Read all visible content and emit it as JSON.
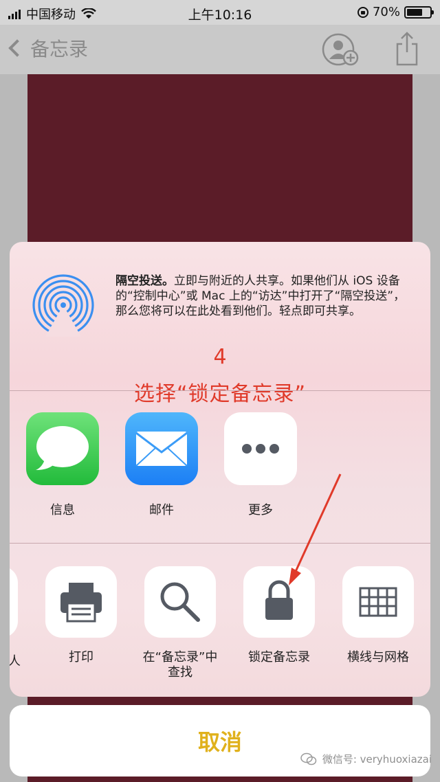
{
  "status_bar": {
    "carrier": "中国移动",
    "time": "上午10:16",
    "battery_percent": "70%",
    "battery_level": 0.7
  },
  "nav": {
    "back_label": "备忘录"
  },
  "share_sheet": {
    "airdrop": {
      "title": "隔空投送。",
      "description": "立即与附近的人共享。如果他们从 iOS 设备的“控制中心”或 Mac 上的“访达”中打开了“隔空投送”，那么您将可以在此处看到他们。轻点即可共享。"
    },
    "annotation": {
      "step_number": "4",
      "instruction": "选择“锁定备忘录”"
    },
    "apps": [
      {
        "label": "信息",
        "icon": "messages-icon"
      },
      {
        "label": "邮件",
        "icon": "mail-icon"
      },
      {
        "label": "更多",
        "icon": "more-icon"
      }
    ],
    "actions": [
      {
        "label": "人",
        "icon": "partial-icon"
      },
      {
        "label": "打印",
        "icon": "printer-icon"
      },
      {
        "label": "在“备忘录”中查找",
        "icon": "search-icon"
      },
      {
        "label": "锁定备忘录",
        "icon": "lock-icon"
      },
      {
        "label": "横线与网格",
        "icon": "grid-icon"
      }
    ]
  },
  "cancel_label": "取消",
  "watermark": "微信号: veryhuoxiazai",
  "colors": {
    "annotation_red": "#e03a2a",
    "cancel_gold": "#e0b11c",
    "note_maroon": "#5b1c28"
  }
}
